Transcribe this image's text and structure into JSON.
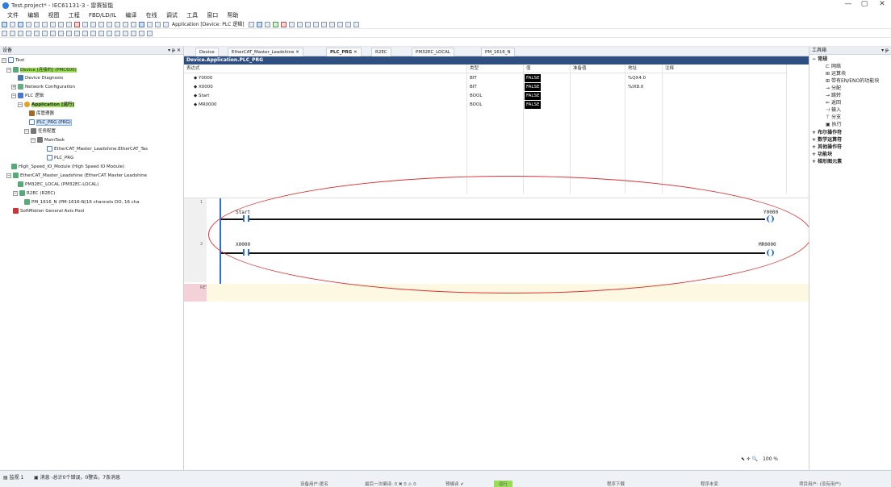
{
  "window": {
    "title": "Test.project* - IEC61131-3 - 雷赛智能",
    "min": "—",
    "max": "▢",
    "close": "✕"
  },
  "menu": [
    "文件",
    "编辑",
    "视图",
    "工程",
    "FBD/LD/IL",
    "编译",
    "在线",
    "调试",
    "工具",
    "窗口",
    "帮助"
  ],
  "toolbar": {
    "application_label": "Application [Device: PLC 逻辑]"
  },
  "devices_panel": {
    "title": "设备",
    "tree": {
      "root": "Test",
      "device": "Device [连接的] (PMC600)",
      "diagnosis": "Device Diagnosis",
      "network": "Network Configuration",
      "plc_logic": "PLC 逻辑",
      "application": "Application [运行]",
      "library": "库管理器",
      "plc_prg": "PLC_PRG (PRG)",
      "task_config": "任务配置",
      "main_task": "MainTask",
      "ethercat_task": "EtherCAT_Master_Leadshine.EtherCAT_Tas",
      "plc_prg_call": "PLC_PRG",
      "hs_io": "High_Speed_IO_Module (High Speed IO Module)",
      "ethercat_master": "EtherCAT_Master_Leadshine (EtherCAT Master Leadshine",
      "pm32ec": "PM32EC_LOCAL (PM32EC-LOCAL)",
      "r2ec": "R2EC (R2EC)",
      "pm1616": "PM_1616_N (PM-1616-N(16 channels DO, 16 cha",
      "softmotion": "SoftMotion General Axis Pool"
    }
  },
  "tabs": [
    "Device",
    "EtherCAT_Master_Leadshine",
    "PLC_PRG",
    "R2EC",
    "PM32EC_LOCAL",
    "PM_1616_N"
  ],
  "editor": {
    "path": "Device.Application.PLC_PRG",
    "columns": {
      "expr": "表达式",
      "type": "类型",
      "value": "值",
      "prepared": "准备值",
      "address": "地址",
      "comment": "注释"
    },
    "variables": [
      {
        "name": "Y0000",
        "type": "BIT",
        "value": "FALSE",
        "address": "%QX4.0"
      },
      {
        "name": "X0000",
        "type": "BIT",
        "value": "FALSE",
        "address": "%IX8.0"
      },
      {
        "name": "Start",
        "type": "BOOL",
        "value": "FALSE",
        "address": ""
      },
      {
        "name": "MR0000",
        "type": "BOOL",
        "value": "FALSE",
        "address": ""
      }
    ],
    "rungs": [
      {
        "num": "1",
        "contact": "Start",
        "coil": "Y0000"
      },
      {
        "num": "2",
        "contact": "X0000",
        "coil": "MR0000"
      }
    ],
    "ret_marker": "RET",
    "zoom": "100 %"
  },
  "toolbox": {
    "title": "工具箱",
    "common": "常规",
    "items": [
      "网络",
      "运算块",
      "带有EN/ENO的功能块",
      "分配",
      "跳转",
      "返回",
      "输入",
      "分支",
      "执行"
    ],
    "categories": [
      "布尔操作符",
      "数学运算符",
      "其他操作符",
      "功能块",
      "梯形图元素"
    ]
  },
  "bottom": {
    "tabs": [
      "监视 1",
      "消息 -总计0个错误，0警告，7条消息"
    ],
    "status": [
      "设备用户:匿名",
      "最后一次编译: 0 ✖ 0 ⚠ 0",
      "预编译 ✔",
      "运行",
      "程序下载",
      "程序未变",
      "项目用户: (没有用户)"
    ]
  },
  "colors": {
    "accent": "#2d6dd6",
    "highlight_green": "#99dd55",
    "annotation_red": "#e03030"
  }
}
